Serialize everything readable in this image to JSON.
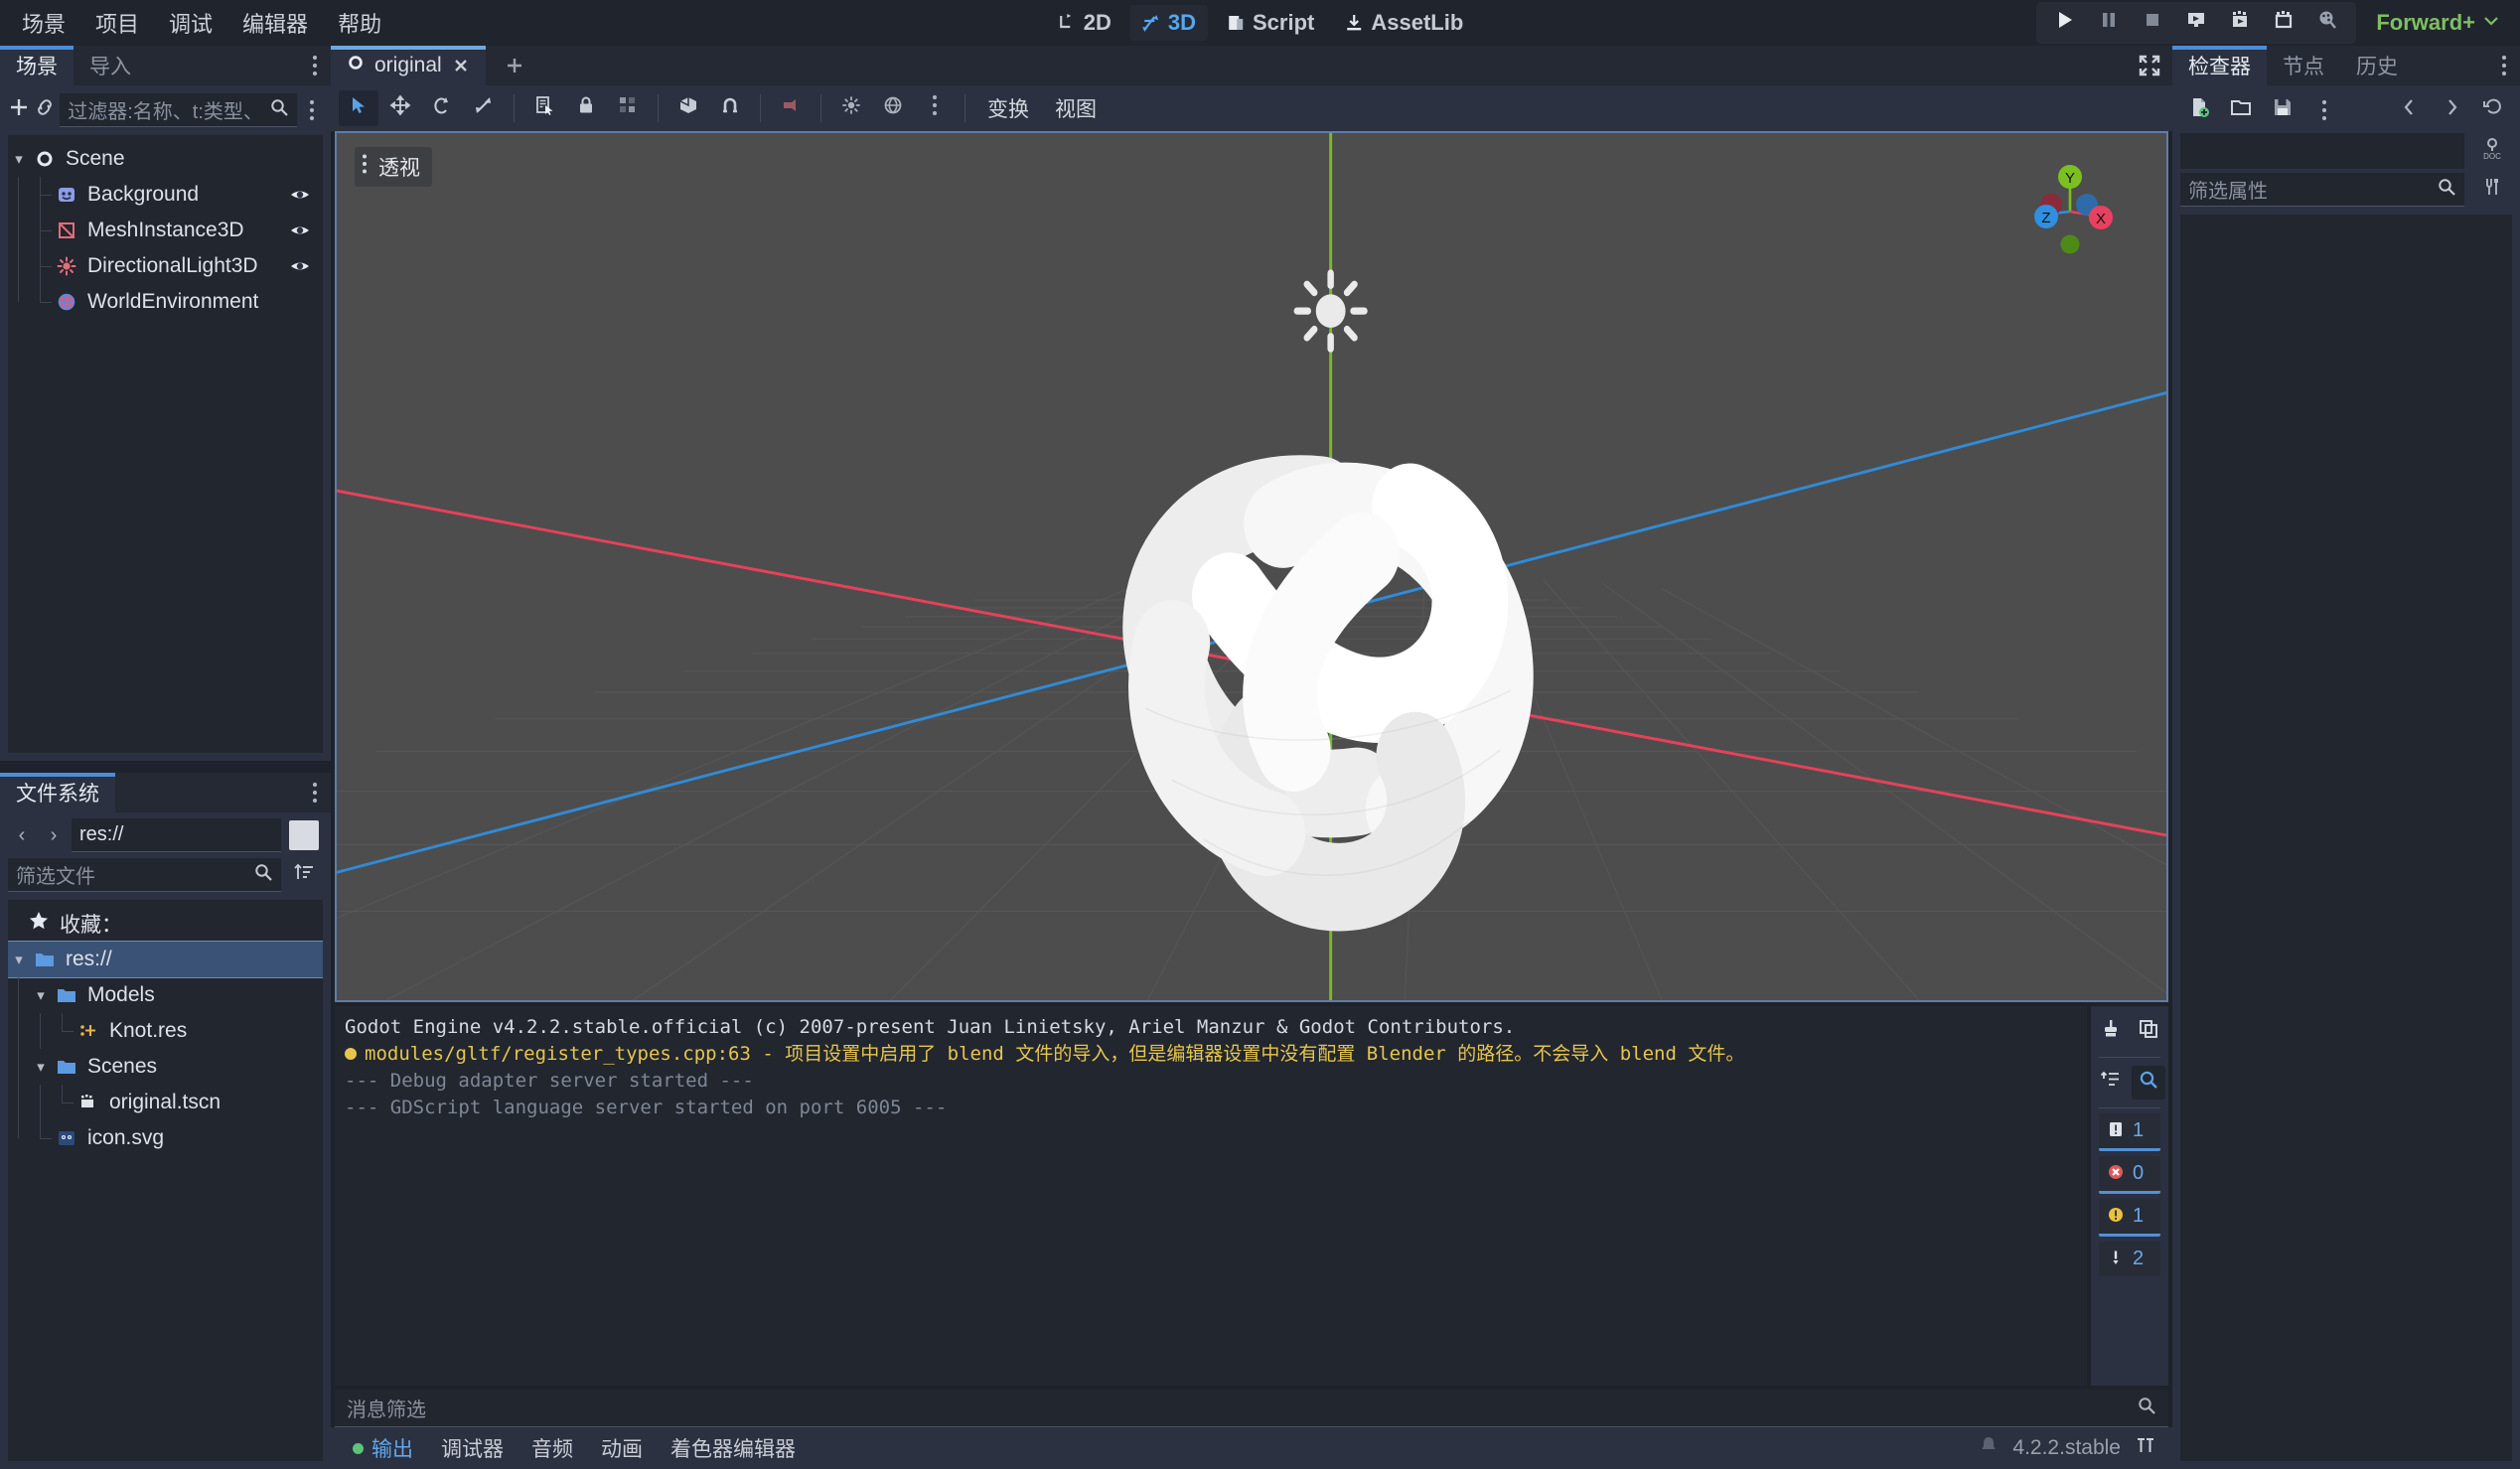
{
  "menubar": {
    "items": [
      {
        "label": "场景",
        "name": "menu-scene"
      },
      {
        "label": "项目",
        "name": "menu-project"
      },
      {
        "label": "调试",
        "name": "menu-debug"
      },
      {
        "label": "编辑器",
        "name": "menu-editor"
      },
      {
        "label": "帮助",
        "name": "menu-help"
      }
    ],
    "modes": [
      {
        "label": "2D",
        "active": false
      },
      {
        "label": "3D",
        "active": true
      },
      {
        "label": "Script",
        "active": false
      },
      {
        "label": "AssetLib",
        "active": false
      }
    ],
    "renderer": "Forward+",
    "accent_blue": "#4c8ed9",
    "renderer_color": "#7fbf5f",
    "play_buttons": [
      "play-icon",
      "pause-icon",
      "stop-icon",
      "play-scene-icon",
      "play-custom-scene-icon",
      "movie-maker-icon",
      "remote-debug-icon"
    ]
  },
  "scene_dock": {
    "tabs": [
      {
        "label": "场景",
        "active": true
      },
      {
        "label": "导入",
        "active": false
      }
    ],
    "filter_placeholder": "过滤器:名称、t:类型、",
    "toolbar": [
      "add-node-icon",
      "instance-scene-icon"
    ],
    "nodes": [
      {
        "label": "Scene",
        "icon": "node3d-icon",
        "depth": 0,
        "eye": false,
        "expanded": true
      },
      {
        "label": "Background",
        "icon": "camera-attributes-icon",
        "depth": 1,
        "eye": true
      },
      {
        "label": "MeshInstance3D",
        "icon": "mesh-instance-icon",
        "depth": 1,
        "eye": true
      },
      {
        "label": "DirectionalLight3D",
        "icon": "directional-light-icon",
        "depth": 1,
        "eye": true
      },
      {
        "label": "WorldEnvironment",
        "icon": "world-environment-icon",
        "depth": 1,
        "eye": false
      }
    ]
  },
  "filesystem_dock": {
    "tabs": [
      {
        "label": "文件系统",
        "active": true
      }
    ],
    "path_value": "res://",
    "filter_placeholder": "筛选文件",
    "favorites_label": "收藏：",
    "entries": [
      {
        "label": "res://",
        "icon": "folder-icon",
        "depth": 0,
        "selected": true,
        "expanded": true
      },
      {
        "label": "Models",
        "icon": "folder-icon",
        "depth": 1,
        "expanded": true
      },
      {
        "label": "Knot.res",
        "icon": "resource-icon",
        "depth": 2
      },
      {
        "label": "Scenes",
        "icon": "folder-icon",
        "depth": 1,
        "expanded": true
      },
      {
        "label": "original.tscn",
        "icon": "scene-icon",
        "depth": 2
      },
      {
        "label": "icon.svg",
        "icon": "godot-icon",
        "depth": 1
      }
    ]
  },
  "scene_tabs": {
    "tabs": [
      {
        "label": "original",
        "icon": "node3d-icon",
        "active": true
      }
    ],
    "add_tab_label": "+"
  },
  "viewport_toolbar": {
    "tools": [
      {
        "name": "select-mode-button",
        "icon": "cursor-icon",
        "active": true
      },
      {
        "name": "move-mode-button",
        "icon": "move-icon",
        "active": false
      },
      {
        "name": "rotate-mode-button",
        "icon": "rotate-icon",
        "active": false
      },
      {
        "name": "scale-mode-button",
        "icon": "scale-icon",
        "active": false
      },
      {
        "name": "list-select-button",
        "icon": "list-select-icon",
        "active": false
      },
      {
        "name": "lock-button",
        "icon": "lock-icon",
        "active": false
      },
      {
        "name": "group-button",
        "icon": "group-icon",
        "active": false
      },
      {
        "name": "local-space-button",
        "icon": "cube-icon",
        "active": false
      },
      {
        "name": "snap-button",
        "icon": "magnet-icon",
        "active": false
      },
      {
        "name": "camera-preview-button",
        "icon": "camera-icon",
        "active": false
      },
      {
        "name": "preview-sun-button",
        "icon": "sun-icon",
        "active": false
      },
      {
        "name": "preview-environment-button",
        "icon": "globe-icon",
        "active": false
      },
      {
        "name": "sun-environment-menu-button",
        "icon": "three-dots-icon",
        "active": false
      }
    ],
    "menus": [
      {
        "label": "变换",
        "name": "transform-menu"
      },
      {
        "label": "视图",
        "name": "view-menu"
      }
    ]
  },
  "viewport": {
    "perspective_label": "透视",
    "gizmo_axes": [
      {
        "label": "Y",
        "color": "#7fbf33"
      },
      {
        "label": "Z",
        "color": "#3b9ae8"
      },
      {
        "label": "X",
        "color": "#e8415f"
      }
    ],
    "background_color": "#4d4d4d",
    "grid_color": "#5c5c5c",
    "x_axis_color": "#f0415a",
    "y_axis_color": "#7cc020",
    "z_axis_color": "#2f8fe0",
    "mesh": "torus-knot",
    "mesh_color": "#f2f2f2",
    "light_gizmo": "directional-light-gizmo"
  },
  "output": {
    "lines": [
      {
        "text": "Godot Engine v4.2.2.stable.official (c) 2007-present Juan Linietsky, Ariel Manzur & Godot Contributors.",
        "type": "normal"
      },
      {
        "text": "modules/gltf/register_types.cpp:63 - 项目设置中启用了 blend 文件的导入，但是编辑器设置中没有配置 Blender 的路径。不会导入 blend 文件。",
        "type": "warn"
      },
      {
        "text": "--- Debug adapter server started ---",
        "type": "dim"
      },
      {
        "text": "--- GDScript language server started on port 6005 ---",
        "type": "dim"
      }
    ],
    "sidebar_tools": [
      {
        "name": "clear-output-button",
        "icon": "brush-icon"
      },
      {
        "name": "copy-output-button",
        "icon": "copy-icon"
      },
      {
        "name": "collapse-output-button",
        "icon": "collapse-icon"
      },
      {
        "name": "search-output-button",
        "icon": "search-icon",
        "active": true
      }
    ],
    "counters": [
      {
        "name": "messages-counter",
        "icon": "message-icon",
        "value": "1"
      },
      {
        "name": "errors-counter",
        "icon": "error-icon",
        "value": "0"
      },
      {
        "name": "warnings-counter",
        "icon": "warning-icon",
        "value": "1"
      },
      {
        "name": "editor-messages-counter",
        "icon": "info-icon",
        "value": "2"
      }
    ],
    "filter_placeholder": "消息筛选"
  },
  "bottom_tabs": {
    "tabs": [
      {
        "label": "输出",
        "active": true,
        "dot": true
      },
      {
        "label": "调试器",
        "active": false
      },
      {
        "label": "音频",
        "active": false
      },
      {
        "label": "动画",
        "active": false
      },
      {
        "label": "着色器编辑器",
        "active": false
      }
    ],
    "version": "4.2.2.stable"
  },
  "inspector": {
    "tabs": [
      {
        "label": "检查器",
        "active": true
      },
      {
        "label": "节点",
        "active": false
      },
      {
        "label": "历史",
        "active": false
      }
    ],
    "toolbar": [
      "new-resource-icon",
      "open-resource-icon",
      "save-resource-icon",
      "resource-menu-icon",
      "back-icon",
      "forward-icon",
      "history-icon"
    ],
    "side_icons": [
      "open-docs-icon",
      "object-tools-icon"
    ],
    "filter_placeholder": "筛选属性",
    "object_value": ""
  }
}
